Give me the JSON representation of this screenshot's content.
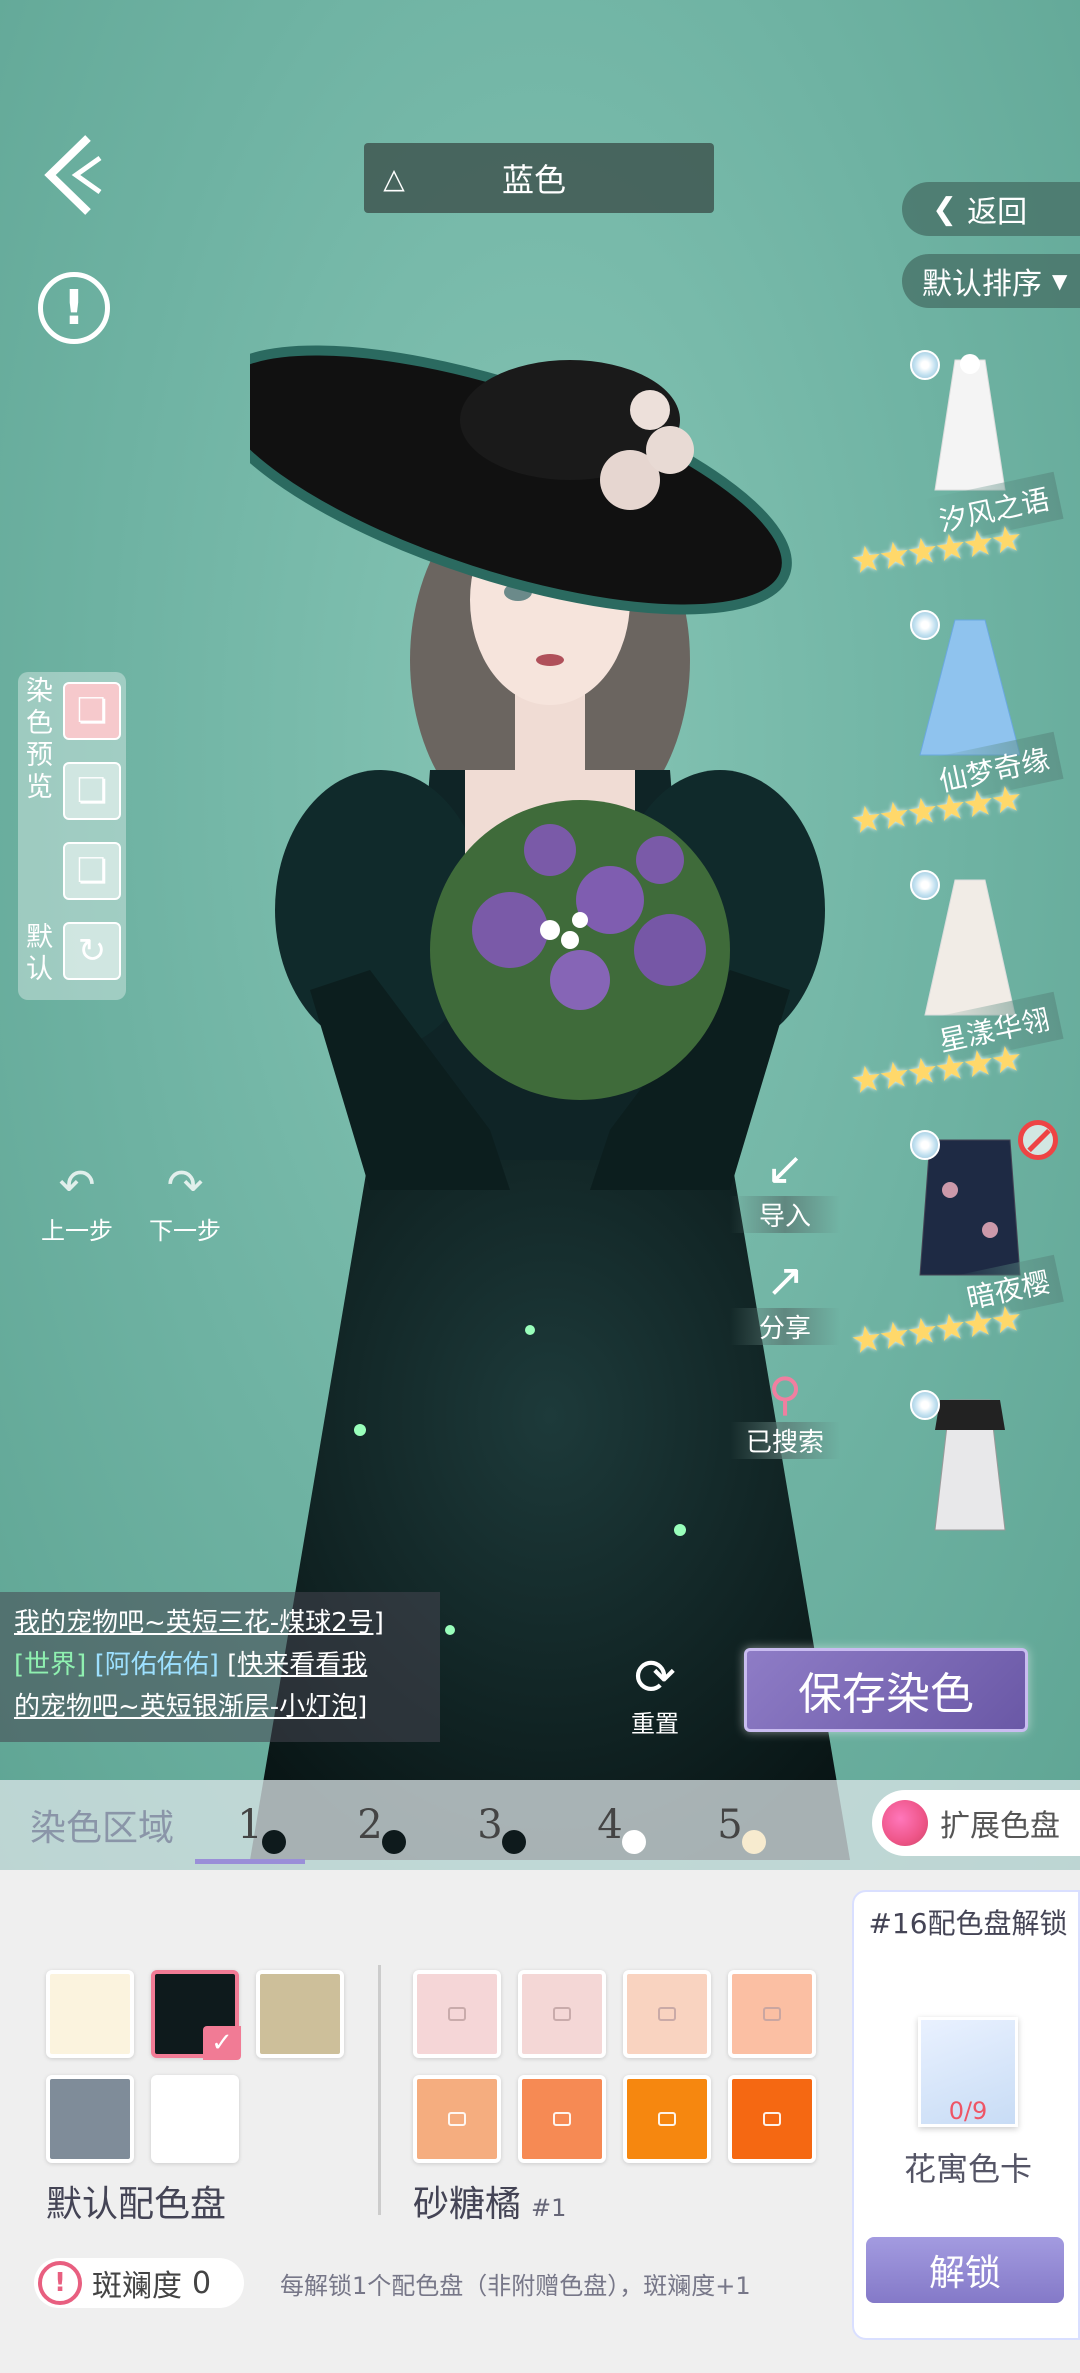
{
  "header": {
    "title": "蓝色",
    "dress_icon": "dress-icon"
  },
  "top_right": {
    "return_label": "返回",
    "sort_label": "默认排序"
  },
  "outfits": [
    {
      "name": "汐风之语",
      "stars": 6
    },
    {
      "name": "仙梦奇缘",
      "stars": 6
    },
    {
      "name": "星漾华翎",
      "stars": 6
    },
    {
      "name": "暗夜樱",
      "stars": 6,
      "restricted": true
    },
    {
      "name": "",
      "stars": 0
    }
  ],
  "dye_preview": {
    "label": "染色预览",
    "default_label": "默认"
  },
  "history": {
    "undo": "上一步",
    "redo": "下一步"
  },
  "actions": {
    "import": "导入",
    "share": "分享",
    "searched": "已搜索"
  },
  "chat": {
    "line1": "我的宠物吧~英短三花-煤球2号]",
    "channel": "[世界]",
    "user": "[阿佑佑佑]",
    "msg_a": "[快来看看我",
    "msg_b": "的宠物吧~英短银渐层-小灯泡]"
  },
  "reset_label": "重置",
  "save_label": "保存染色",
  "zones": {
    "title": "染色区域",
    "tabs": [
      {
        "num": "1",
        "dot": "#0e1a1c"
      },
      {
        "num": "2",
        "dot": "#0e1a1c"
      },
      {
        "num": "3",
        "dot": "#0e1a1c"
      },
      {
        "num": "4",
        "dot": "#ffffff"
      },
      {
        "num": "5",
        "dot": "#f7ebcf"
      }
    ],
    "expand_label": "扩展色盘"
  },
  "palettes": {
    "default_name": "默认配色盘",
    "default_colors": [
      "#fbf3de",
      "#0e1a1c",
      "#cdbf9a",
      "#7f8c99",
      "#ffffff"
    ],
    "orange_name": "砂糖橘",
    "orange_sub": "#1",
    "orange_colors": [
      "#f5d6d7",
      "#f4d7d6",
      "#f9d3c0",
      "#fbbfa3",
      "#f5ad7f",
      "#f68a54",
      "#f6870f",
      "#f56812"
    ]
  },
  "unlock": {
    "title": "#16配色盘解锁",
    "count": "0/9",
    "card_name": "花寓色卡",
    "button": "解锁"
  },
  "brilliance": {
    "label": "斑斓度",
    "value": "0"
  },
  "hint": "每解锁1个配色盘（非附赠色盘），斑斓度+1"
}
